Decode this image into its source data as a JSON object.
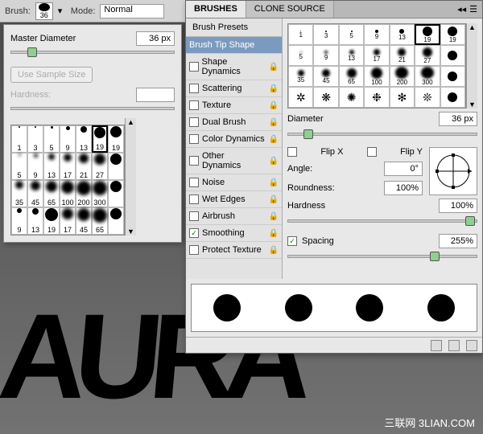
{
  "toolbar": {
    "brush_label": "Brush:",
    "brush_size": "36",
    "mode_label": "Mode:",
    "mode_value": "Normal"
  },
  "presets": {
    "master_diameter_label": "Master Diameter",
    "master_diameter_value": "36 px",
    "sample_btn": "Use Sample Size",
    "hardness_label": "Hardness:",
    "hardness_value": "",
    "grid": [
      {
        "s": 2,
        "l": "1"
      },
      {
        "s": 2,
        "l": "3"
      },
      {
        "s": 3,
        "l": "5"
      },
      {
        "s": 5,
        "l": "9"
      },
      {
        "s": 8,
        "l": "13"
      },
      {
        "s": 14,
        "l": "19",
        "sel": true
      },
      {
        "s": 14,
        "l": "19"
      },
      {
        "s": 3,
        "l": "5",
        "soft": true
      },
      {
        "s": 5,
        "l": "9",
        "soft": true
      },
      {
        "s": 8,
        "l": "13",
        "soft": true
      },
      {
        "s": 10,
        "l": "17",
        "soft": true
      },
      {
        "s": 12,
        "l": "21",
        "soft": true
      },
      {
        "s": 14,
        "l": "27",
        "soft": true
      },
      {
        "s": 14,
        "l": ""
      },
      {
        "s": 10,
        "l": "35",
        "soft": true
      },
      {
        "s": 12,
        "l": "45",
        "soft": true
      },
      {
        "s": 14,
        "l": "65",
        "soft": true
      },
      {
        "s": 16,
        "l": "100",
        "soft": true
      },
      {
        "s": 18,
        "l": "200",
        "soft": true
      },
      {
        "s": 18,
        "l": "300",
        "soft": true
      },
      {
        "s": 14,
        "l": ""
      },
      {
        "s": 6,
        "l": "9"
      },
      {
        "s": 8,
        "l": "13"
      },
      {
        "s": 16,
        "l": "19"
      },
      {
        "s": 14,
        "l": "17",
        "soft": true
      },
      {
        "s": 16,
        "l": "45",
        "soft": true
      },
      {
        "s": 18,
        "l": "65",
        "soft": true
      },
      {
        "s": 14,
        "l": ""
      }
    ]
  },
  "brushes_panel": {
    "tabs": {
      "brushes": "BRUSHES",
      "clone": "CLONE SOURCE"
    },
    "presets_label": "Brush Presets",
    "options": [
      {
        "label": "Brush Tip Shape",
        "active": true,
        "check": false,
        "lock": false
      },
      {
        "label": "Shape Dynamics",
        "check": false,
        "lock": true
      },
      {
        "label": "Scattering",
        "check": false,
        "lock": true
      },
      {
        "label": "Texture",
        "check": false,
        "lock": true
      },
      {
        "label": "Dual Brush",
        "check": false,
        "lock": true
      },
      {
        "label": "Color Dynamics",
        "check": false,
        "lock": true
      },
      {
        "label": "Other Dynamics",
        "check": false,
        "lock": true
      },
      {
        "label": "Noise",
        "check": false,
        "lock": true
      },
      {
        "label": "Wet Edges",
        "check": false,
        "lock": true
      },
      {
        "label": "Airbrush",
        "check": false,
        "lock": true
      },
      {
        "label": "Smoothing",
        "check": true,
        "lock": true
      },
      {
        "label": "Protect Texture",
        "check": false,
        "lock": true
      }
    ],
    "mini_grid": [
      {
        "s": 1,
        "l": "1"
      },
      {
        "s": 2,
        "l": "3"
      },
      {
        "s": 2,
        "l": "5"
      },
      {
        "s": 4,
        "l": "9"
      },
      {
        "s": 6,
        "l": "13"
      },
      {
        "s": 12,
        "l": "19",
        "sel": true
      },
      {
        "s": 12,
        "l": "19"
      },
      {
        "s": 2,
        "l": "5",
        "soft": true
      },
      {
        "s": 4,
        "l": "9",
        "soft": true
      },
      {
        "s": 6,
        "l": "13",
        "soft": true
      },
      {
        "s": 8,
        "l": "17",
        "soft": true
      },
      {
        "s": 10,
        "l": "21",
        "soft": true
      },
      {
        "s": 12,
        "l": "27",
        "soft": true
      },
      {
        "s": 12,
        "l": ""
      },
      {
        "s": 8,
        "l": "35",
        "soft": true
      },
      {
        "s": 10,
        "l": "45",
        "soft": true
      },
      {
        "s": 12,
        "l": "65",
        "soft": true
      },
      {
        "s": 14,
        "l": "100",
        "soft": true
      },
      {
        "s": 16,
        "l": "200",
        "soft": true
      },
      {
        "s": 16,
        "l": "300",
        "soft": true
      },
      {
        "s": 12,
        "l": ""
      },
      {
        "scatter": "✲"
      },
      {
        "scatter": "❋"
      },
      {
        "scatter": "✺"
      },
      {
        "scatter": "❉"
      },
      {
        "scatter": "✻"
      },
      {
        "scatter": "❊"
      },
      {
        "s": 12,
        "l": ""
      }
    ],
    "diameter_label": "Diameter",
    "diameter_value": "36 px",
    "flipx_label": "Flip X",
    "flipy_label": "Flip Y",
    "angle_label": "Angle:",
    "angle_value": "0°",
    "roundness_label": "Roundness:",
    "roundness_value": "100%",
    "hardness_label": "Hardness",
    "hardness_value": "100%",
    "spacing_label": "Spacing",
    "spacing_value": "255%"
  },
  "watermark": "三联网 3LIAN.COM",
  "canvas_text": "AURA"
}
